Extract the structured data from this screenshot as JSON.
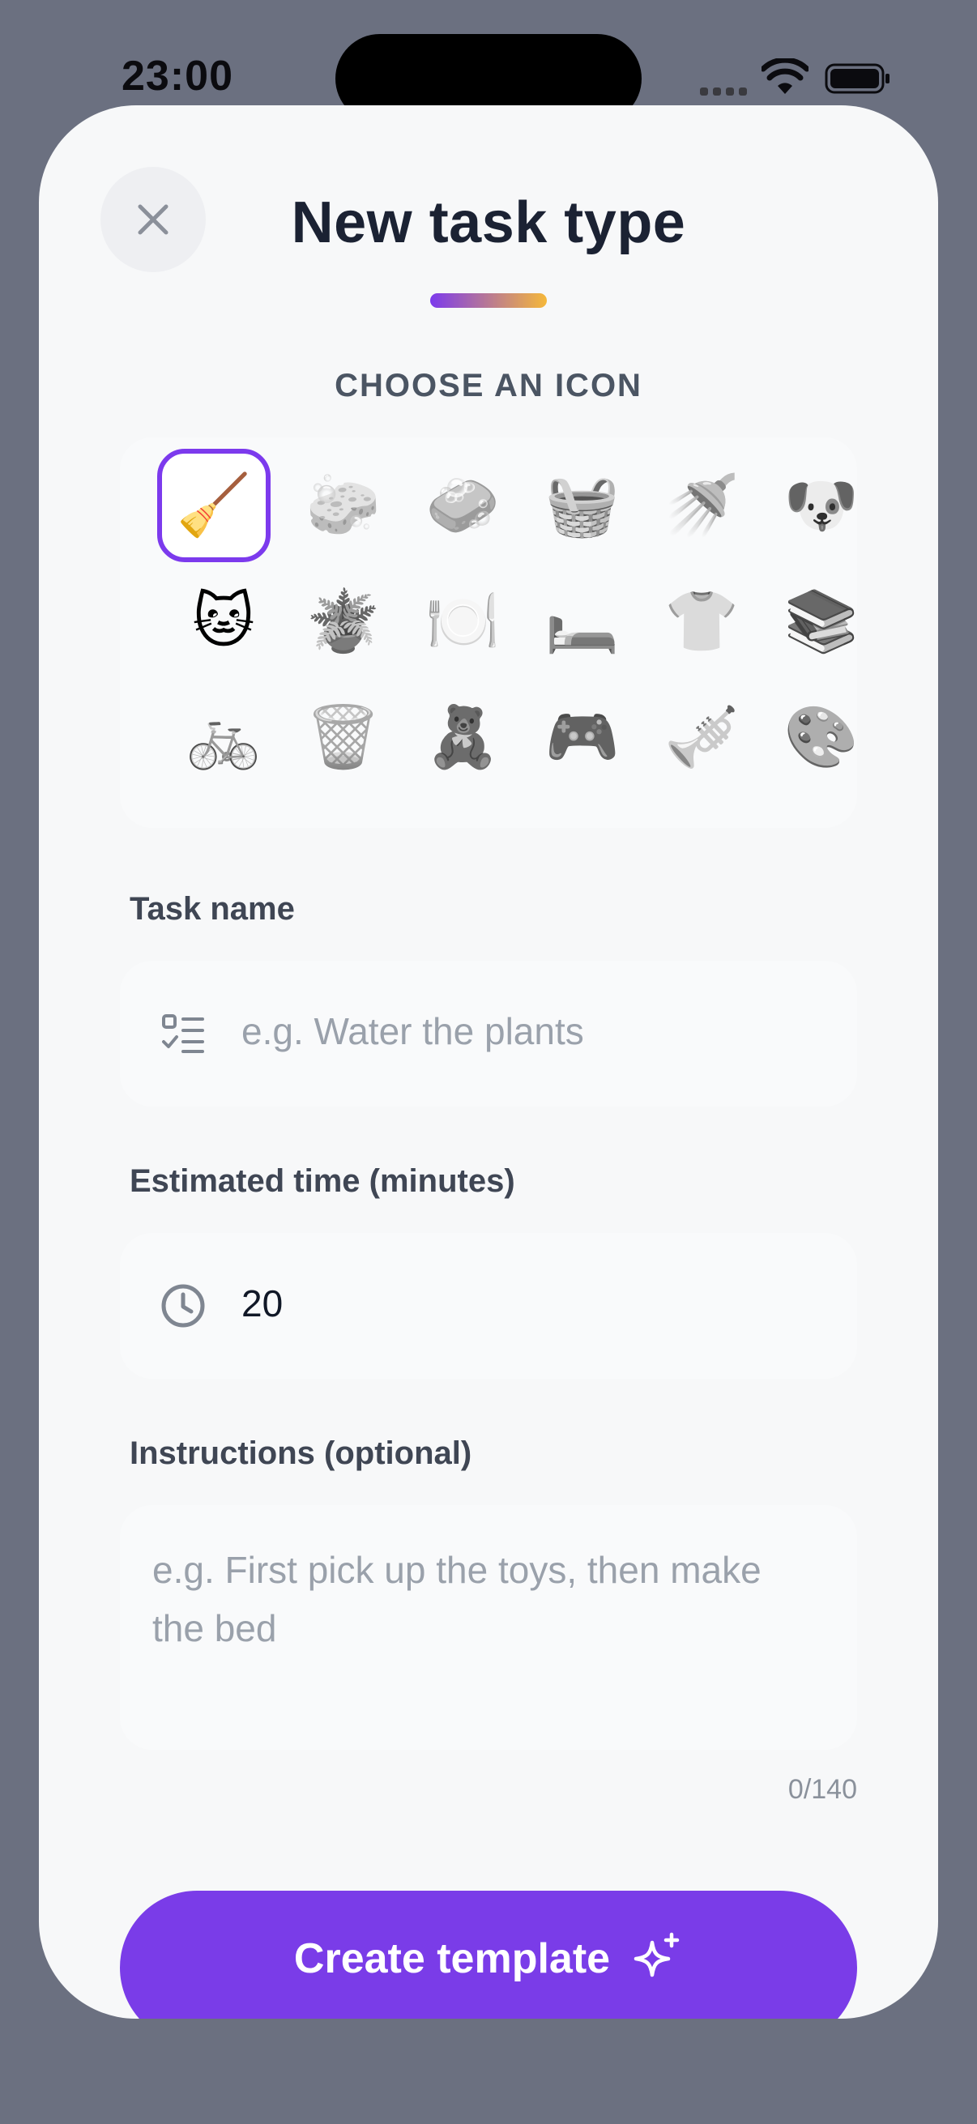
{
  "status_bar": {
    "time": "23:00"
  },
  "header": {
    "title": "New task type"
  },
  "icon_picker": {
    "section_label": "CHOOSE AN ICON",
    "selected_index": 0,
    "icons": [
      {
        "name": "broom",
        "glyph": "🧹"
      },
      {
        "name": "sponge",
        "glyph": "🧽"
      },
      {
        "name": "soap",
        "glyph": "🧼"
      },
      {
        "name": "basket",
        "glyph": "🧺"
      },
      {
        "name": "shower",
        "glyph": "🚿"
      },
      {
        "name": "dog-face",
        "glyph": "🐶"
      },
      {
        "name": "cat-face",
        "glyph": "🐱"
      },
      {
        "name": "potted-plant",
        "glyph": "🪴"
      },
      {
        "name": "plate-with-cutlery",
        "glyph": "🍽️"
      },
      {
        "name": "bed",
        "glyph": "🛏️"
      },
      {
        "name": "t-shirt",
        "glyph": "👕"
      },
      {
        "name": "books",
        "glyph": "📚"
      },
      {
        "name": "bicycle",
        "glyph": "🚲"
      },
      {
        "name": "wastebasket",
        "glyph": "🗑️"
      },
      {
        "name": "teddy-bear",
        "glyph": "🧸"
      },
      {
        "name": "game-controller",
        "glyph": "🎮"
      },
      {
        "name": "trumpet",
        "glyph": "🎺"
      },
      {
        "name": "artist-palette",
        "glyph": "🎨"
      }
    ]
  },
  "task_name": {
    "label": "Task name",
    "placeholder": "e.g. Water the plants"
  },
  "estimated_time": {
    "label": "Estimated time (minutes)",
    "value": "20"
  },
  "instructions": {
    "label": "Instructions (optional)",
    "placeholder": "e.g. First pick up the toys, then make the bed",
    "counter": "0/140"
  },
  "submit": {
    "label": "Create template"
  },
  "colors": {
    "accent": "#7a3ce8",
    "gradient_start": "#7c3aed",
    "gradient_end": "#f5b83a"
  }
}
